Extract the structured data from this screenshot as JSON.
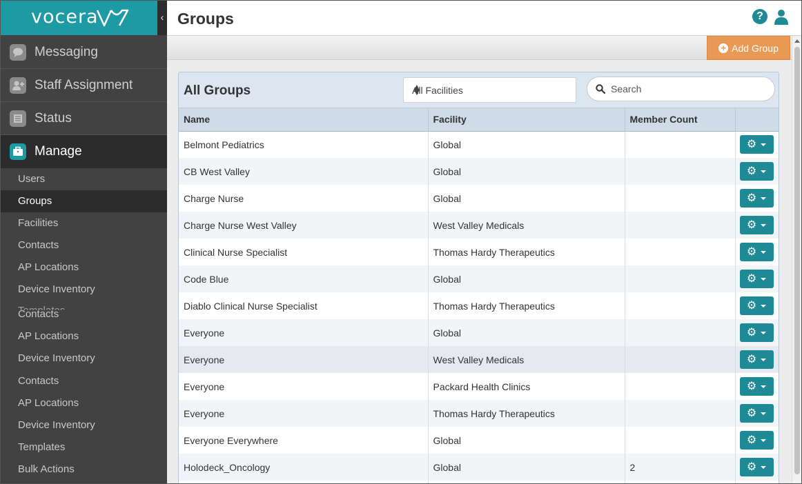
{
  "brand": {
    "logo_text": "vocera",
    "accent": "#1d9aa3"
  },
  "sidebar": {
    "collapse_glyph": "‹",
    "main_items": [
      {
        "label": "Messaging",
        "icon": "chat-icon"
      },
      {
        "label": "Staff Assignment",
        "icon": "add-user-icon"
      },
      {
        "label": "Status",
        "icon": "list-icon"
      },
      {
        "label": "Manage",
        "icon": "briefcase-icon",
        "active": true
      }
    ],
    "sub_items": [
      {
        "label": "Users"
      },
      {
        "label": "Groups",
        "active": true
      },
      {
        "label": "Facilities"
      },
      {
        "label": "Contacts"
      },
      {
        "label": "AP Locations"
      },
      {
        "label": "Device Inventory"
      },
      {
        "label": "Contacts"
      },
      {
        "label": "AP Locations"
      },
      {
        "label": "Device Inventory"
      },
      {
        "label": "Contacts"
      },
      {
        "label": "AP Locations"
      },
      {
        "label": "Device Inventory"
      },
      {
        "label": "Templates"
      },
      {
        "label": "Bulk Actions"
      }
    ],
    "ghost_label": "Templates"
  },
  "header": {
    "title": "Groups",
    "help_glyph": "?"
  },
  "action_bar": {
    "add_label": "Add Group"
  },
  "panel": {
    "title": "All Groups",
    "facility_filter": "All Facilities",
    "search_placeholder": "Search"
  },
  "table": {
    "columns": [
      "Name",
      "Facility",
      "Member Count",
      ""
    ],
    "rows": [
      {
        "name": "Belmont Pediatrics",
        "facility": "Global",
        "count": ""
      },
      {
        "name": "CB West Valley",
        "facility": "Global",
        "count": ""
      },
      {
        "name": "Charge Nurse",
        "facility": "Global",
        "count": ""
      },
      {
        "name": "Charge Nurse West Valley",
        "facility": "West Valley Medicals",
        "count": ""
      },
      {
        "name": "Clinical Nurse Specialist",
        "facility": "Thomas Hardy Therapeutics",
        "count": ""
      },
      {
        "name": "Code Blue",
        "facility": "Global",
        "count": ""
      },
      {
        "name": "Diablo Clinical Nurse Specialist",
        "facility": "Thomas Hardy Therapeutics",
        "count": ""
      },
      {
        "name": "Everyone",
        "facility": "Global",
        "count": ""
      },
      {
        "name": "Everyone",
        "facility": "West Valley Medicals",
        "count": ""
      },
      {
        "name": "Everyone",
        "facility": "Packard Health Clinics",
        "count": ""
      },
      {
        "name": "Everyone",
        "facility": "Thomas Hardy Therapeutics",
        "count": ""
      },
      {
        "name": "Everyone Everywhere",
        "facility": "Global",
        "count": ""
      },
      {
        "name": "Holodeck_Oncology",
        "facility": "Global",
        "count": "2"
      },
      {
        "name": "",
        "facility": "",
        "count": ""
      }
    ],
    "gear_glyph": "⚙"
  }
}
